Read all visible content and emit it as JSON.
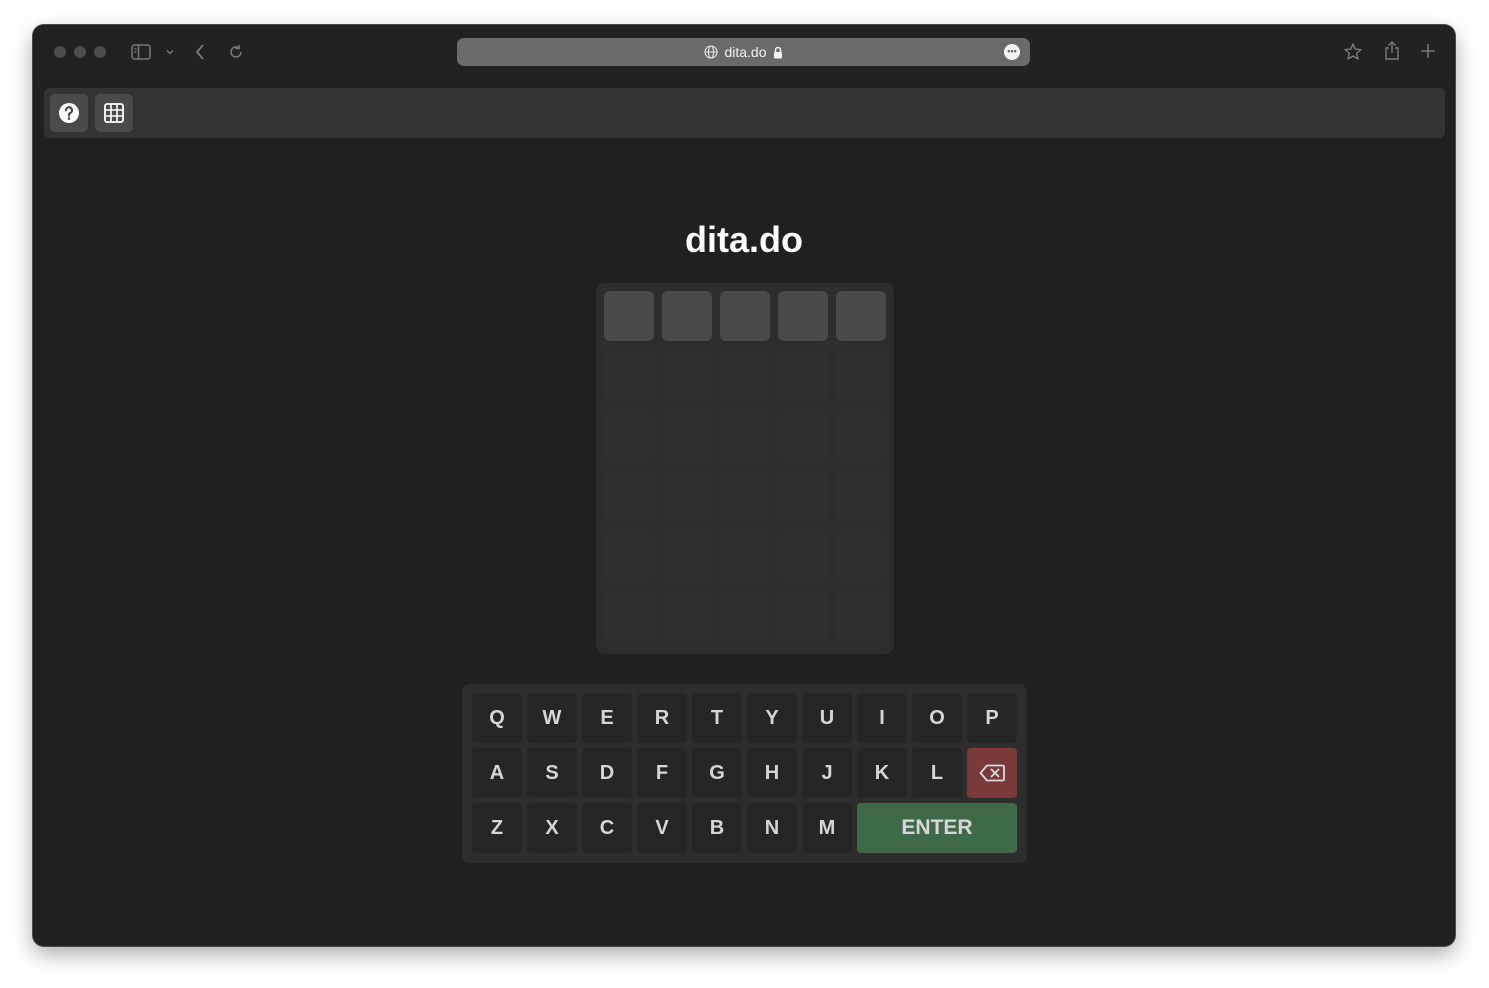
{
  "browser": {
    "url": "dita.do",
    "icons": {
      "sidebar": "sidebar-icon",
      "back": "chevron-left-icon",
      "reload": "reload-icon",
      "site": "globe-icon",
      "secure": "lock-icon",
      "more": "ellipsis-icon",
      "bookmark": "star-icon",
      "share": "share-icon",
      "new_tab": "plus-icon"
    }
  },
  "toolbar": {
    "buttons": [
      {
        "name": "help-button",
        "icon": "question-circle-icon"
      },
      {
        "name": "grid-button",
        "icon": "grid-icon"
      }
    ]
  },
  "game": {
    "title": "dita.do",
    "rows": 6,
    "columns": 5,
    "active_row": 1,
    "letters": []
  },
  "keyboard": {
    "row1": [
      "Q",
      "W",
      "E",
      "R",
      "T",
      "Y",
      "U",
      "I",
      "O",
      "P"
    ],
    "row2": [
      "A",
      "S",
      "D",
      "F",
      "G",
      "H",
      "J",
      "K",
      "L"
    ],
    "row3": [
      "Z",
      "X",
      "C",
      "V",
      "B",
      "N",
      "M"
    ],
    "backspace_icon": "backspace-icon",
    "enter_label": "ENTER"
  },
  "colors": {
    "page_background": "#202020",
    "tile_active": "#4a4a4a",
    "tile_empty": "#2f2f2f",
    "key": "#262626",
    "enter_key": "#3f6a49",
    "backspace_key": "#7a3a3a"
  }
}
